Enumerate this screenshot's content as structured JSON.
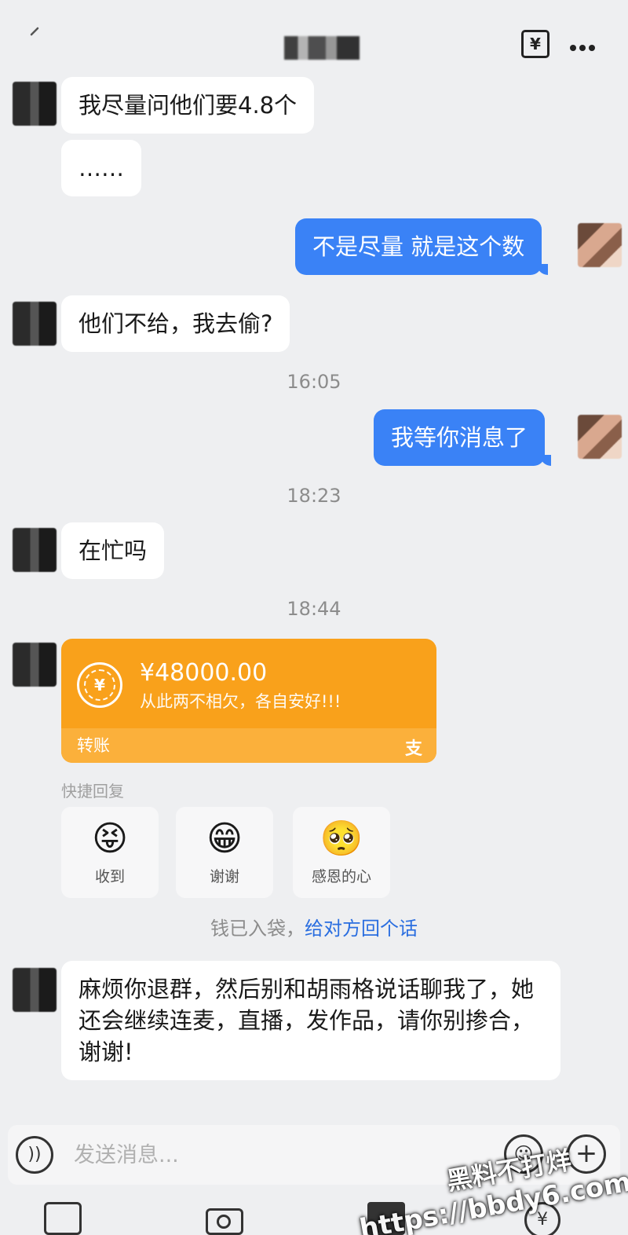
{
  "header": {
    "transfer_symbol": "¥",
    "more_icon": "more-dots-icon"
  },
  "messages": [
    {
      "from": "them",
      "text": "我尽量问他们要4.8个"
    },
    {
      "from": "them",
      "text": "……"
    },
    {
      "from": "me",
      "text": "不是尽量 就是这个数"
    },
    {
      "from": "them",
      "text": "他们不给，我去偷?"
    },
    {
      "type": "time",
      "text": "16:05"
    },
    {
      "from": "me",
      "text": "我等你消息了"
    },
    {
      "type": "time",
      "text": "18:23"
    },
    {
      "from": "them",
      "text": "在忙吗"
    },
    {
      "type": "time",
      "text": "18:44"
    },
    {
      "from": "them",
      "text": "麻烦你退群，然后别和胡雨格说话聊我了，她还会继续连麦，直播，发作品，请你别掺合，谢谢!"
    }
  ],
  "transfer_card": {
    "amount": "¥48000.00",
    "note": "从此两不相欠，各自安好!!!",
    "label": "转账",
    "coin_symbol": "¥",
    "brand_symbol": "支",
    "accent_color": "#f9a11b"
  },
  "quick_reply": {
    "title": "快捷回复",
    "items": [
      {
        "emoji": "😝",
        "label": "收到"
      },
      {
        "emoji": "😁",
        "label": "谢谢"
      },
      {
        "emoji": "🥺",
        "label": "感恩的心"
      }
    ]
  },
  "tip": {
    "text": "钱已入袋，",
    "link": "给对方回个话"
  },
  "input": {
    "placeholder": "发送消息..."
  },
  "watermark": {
    "line1": "黑料不打烊",
    "line2": "https://bbdy6.com"
  },
  "colors": {
    "mine_bubble": "#3a82f6",
    "link": "#2a6ee0",
    "background": "#eeeff1"
  }
}
